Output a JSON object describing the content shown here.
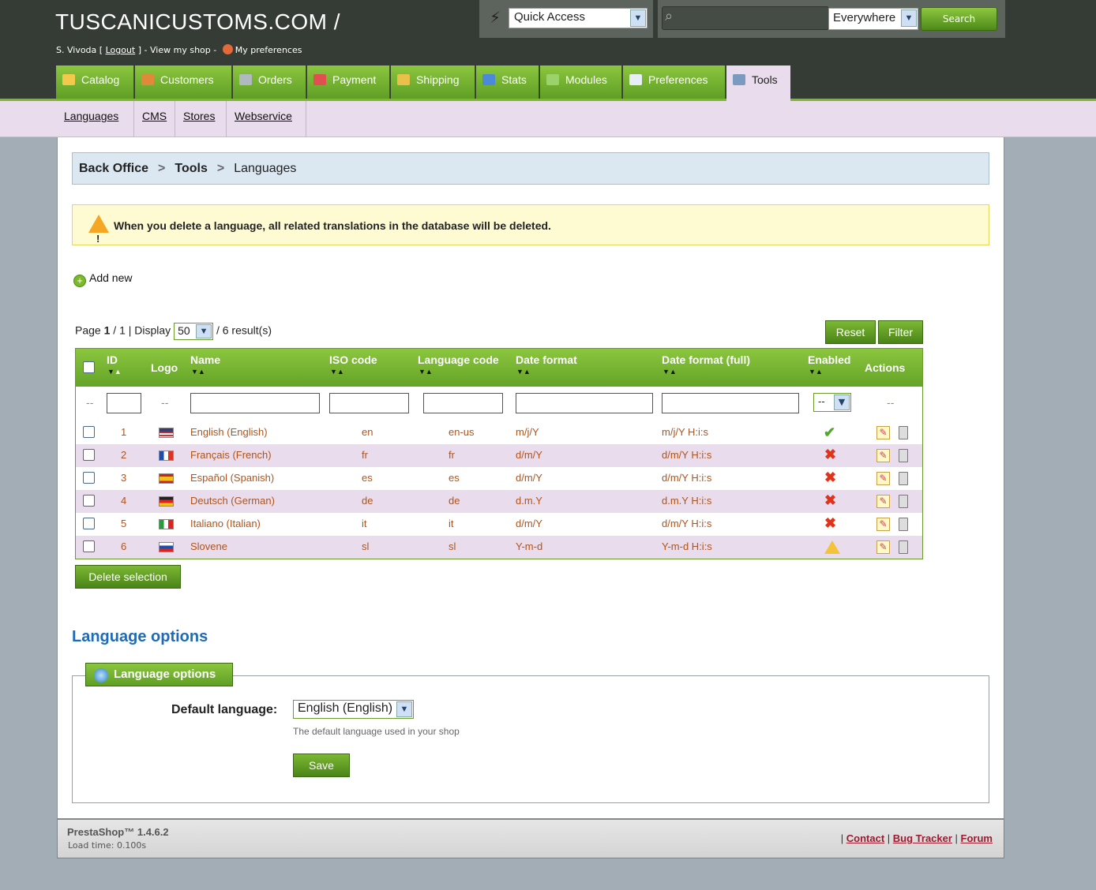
{
  "header": {
    "shop_title": "TUSCANICUSTOMS.COM /",
    "user_name": "S. Vivoda",
    "logout_label": "Logout",
    "view_shop_label": "View my shop",
    "preferences_label": "My preferences",
    "quick_access_label": "Quick Access",
    "search_scope": "Everywhere",
    "search_button": "Search"
  },
  "tabs": [
    {
      "label": "Catalog",
      "color": "#f2c94c"
    },
    {
      "label": "Customers",
      "color": "#e0893a"
    },
    {
      "label": "Orders",
      "color": "#b0b8c0"
    },
    {
      "label": "Payment",
      "color": "#e05050"
    },
    {
      "label": "Shipping",
      "color": "#e8c04a"
    },
    {
      "label": "Stats",
      "color": "#4a8ad8"
    },
    {
      "label": "Modules",
      "color": "#9bd36a"
    },
    {
      "label": "Preferences",
      "color": "#e8eef5"
    },
    {
      "label": "Tools",
      "color": "#7a9ac0",
      "active": true
    }
  ],
  "subnav": [
    "Languages",
    "CMS",
    "Stores",
    "Webservice"
  ],
  "breadcrumb": [
    "Back Office",
    "Tools",
    "Languages"
  ],
  "warning": "When you delete a language, all related translations in the database will be deleted.",
  "add_new_label": "Add new",
  "pager": {
    "page_label": "Page",
    "current": "1",
    "total": "1",
    "display_label": "Display",
    "per_page": "50",
    "results": "6 result(s)"
  },
  "buttons": {
    "reset": "Reset",
    "filter": "Filter",
    "delete_selection": "Delete selection",
    "save": "Save"
  },
  "table": {
    "headers": [
      "ID",
      "Logo",
      "Name",
      "ISO code",
      "Language code",
      "Date format",
      "Date format (full)",
      "Enabled",
      "Actions"
    ],
    "enabled_filter": "--",
    "filter_dash": "--",
    "rows": [
      {
        "id": "1",
        "flag": "us",
        "name": "English (English)",
        "iso": "en",
        "lang": "en-us",
        "date": "m/j/Y",
        "date_full": "m/j/Y H:i:s",
        "status": "enabled"
      },
      {
        "id": "2",
        "flag": "fr",
        "name": "Français (French)",
        "iso": "fr",
        "lang": "fr",
        "date": "d/m/Y",
        "date_full": "d/m/Y H:i:s",
        "status": "disabled"
      },
      {
        "id": "3",
        "flag": "es",
        "name": "Español (Spanish)",
        "iso": "es",
        "lang": "es",
        "date": "d/m/Y",
        "date_full": "d/m/Y H:i:s",
        "status": "disabled"
      },
      {
        "id": "4",
        "flag": "de",
        "name": "Deutsch (German)",
        "iso": "de",
        "lang": "de",
        "date": "d.m.Y",
        "date_full": "d.m.Y H:i:s",
        "status": "disabled"
      },
      {
        "id": "5",
        "flag": "it",
        "name": "Italiano (Italian)",
        "iso": "it",
        "lang": "it",
        "date": "d/m/Y",
        "date_full": "d/m/Y H:i:s",
        "status": "disabled"
      },
      {
        "id": "6",
        "flag": "si",
        "name": "Slovene",
        "iso": "sl",
        "lang": "sl",
        "date": "Y-m-d",
        "date_full": "Y-m-d H:i:s",
        "status": "warning"
      }
    ]
  },
  "language_options": {
    "section_title": "Language options",
    "legend": "Language options",
    "default_label": "Default language:",
    "default_value": "English (English)",
    "help": "The default language used in your shop"
  },
  "footer": {
    "brand": "PrestaShop™ 1.4.6.2",
    "load_time": "Load time: 0.100s",
    "links": [
      "Contact",
      "Bug Tracker",
      "Forum"
    ]
  }
}
